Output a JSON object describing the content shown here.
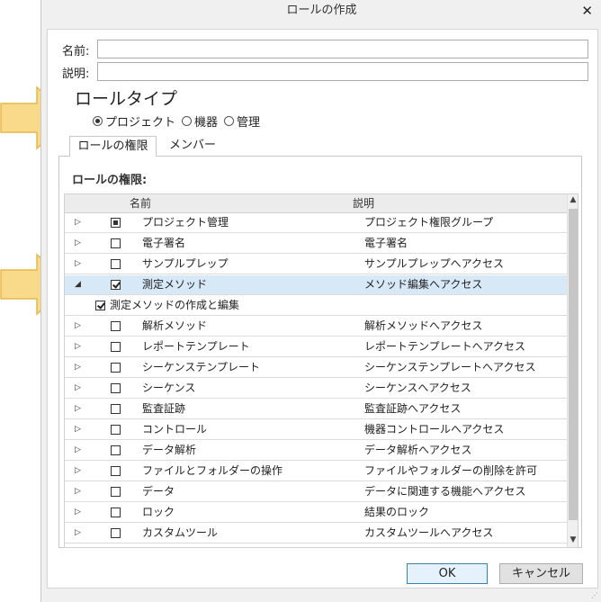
{
  "window": {
    "title": "ロールの作成"
  },
  "form": {
    "name_label": "名前:",
    "name_value": "",
    "description_label": "説明:",
    "description_value": ""
  },
  "role_type": {
    "title": "ロールタイプ",
    "options": [
      {
        "label": "プロジェクト",
        "selected": true
      },
      {
        "label": "機器",
        "selected": false
      },
      {
        "label": "管理",
        "selected": false
      }
    ]
  },
  "tabs": [
    {
      "label": "ロールの権限",
      "active": true
    },
    {
      "label": "メンバー",
      "active": false
    }
  ],
  "permissions": {
    "heading": "ロールの権限:",
    "columns": {
      "name": "名前",
      "description": "説明"
    },
    "rows": [
      {
        "name": "プロジェクト管理",
        "description": "プロジェクト権限グループ",
        "check": "mixed",
        "expanded": false
      },
      {
        "name": "電子署名",
        "description": "電子署名",
        "check": "unchecked",
        "expanded": false
      },
      {
        "name": "サンプルプレップ",
        "description": "サンプルプレップへアクセス",
        "check": "unchecked",
        "expanded": false
      },
      {
        "name": "測定メソッド",
        "description": "メソッド編集へアクセス",
        "check": "checked",
        "expanded": true,
        "selected": true
      },
      {
        "name": "解析メソッド",
        "description": "解析メソッドへアクセス",
        "check": "unchecked",
        "expanded": false
      },
      {
        "name": "レポートテンプレート",
        "description": "レポートテンプレートへアクセス",
        "check": "unchecked",
        "expanded": false
      },
      {
        "name": "シーケンステンプレート",
        "description": "シーケンステンプレートへアクセス",
        "check": "unchecked",
        "expanded": false
      },
      {
        "name": "シーケンス",
        "description": "シーケンスへアクセス",
        "check": "unchecked",
        "expanded": false
      },
      {
        "name": "監査証跡",
        "description": "監査証跡へアクセス",
        "check": "unchecked",
        "expanded": false
      },
      {
        "name": "コントロール",
        "description": "機器コントロールへアクセス",
        "check": "unchecked",
        "expanded": false
      },
      {
        "name": "データ解析",
        "description": "データ解析へアクセス",
        "check": "unchecked",
        "expanded": false
      },
      {
        "name": "ファイルとフォルダーの操作",
        "description": "ファイルやフォルダーの削除を許可",
        "check": "unchecked",
        "expanded": false
      },
      {
        "name": "データ",
        "description": "データに関連する機能へアクセス",
        "check": "unchecked",
        "expanded": false
      },
      {
        "name": "ロック",
        "description": "結果のロック",
        "check": "unchecked",
        "expanded": false
      },
      {
        "name": "カスタムツール",
        "description": "カスタムツールへアクセス",
        "check": "unchecked",
        "expanded": false
      }
    ],
    "subitem": {
      "label": "測定メソッドの作成と編集",
      "checked": true
    }
  },
  "buttons": {
    "ok": "OK",
    "cancel": "キャンセル"
  },
  "colors": {
    "arrow_fill": "#f9d98a",
    "arrow_stroke": "#e6b84e",
    "selection": "#d7e8f7"
  }
}
